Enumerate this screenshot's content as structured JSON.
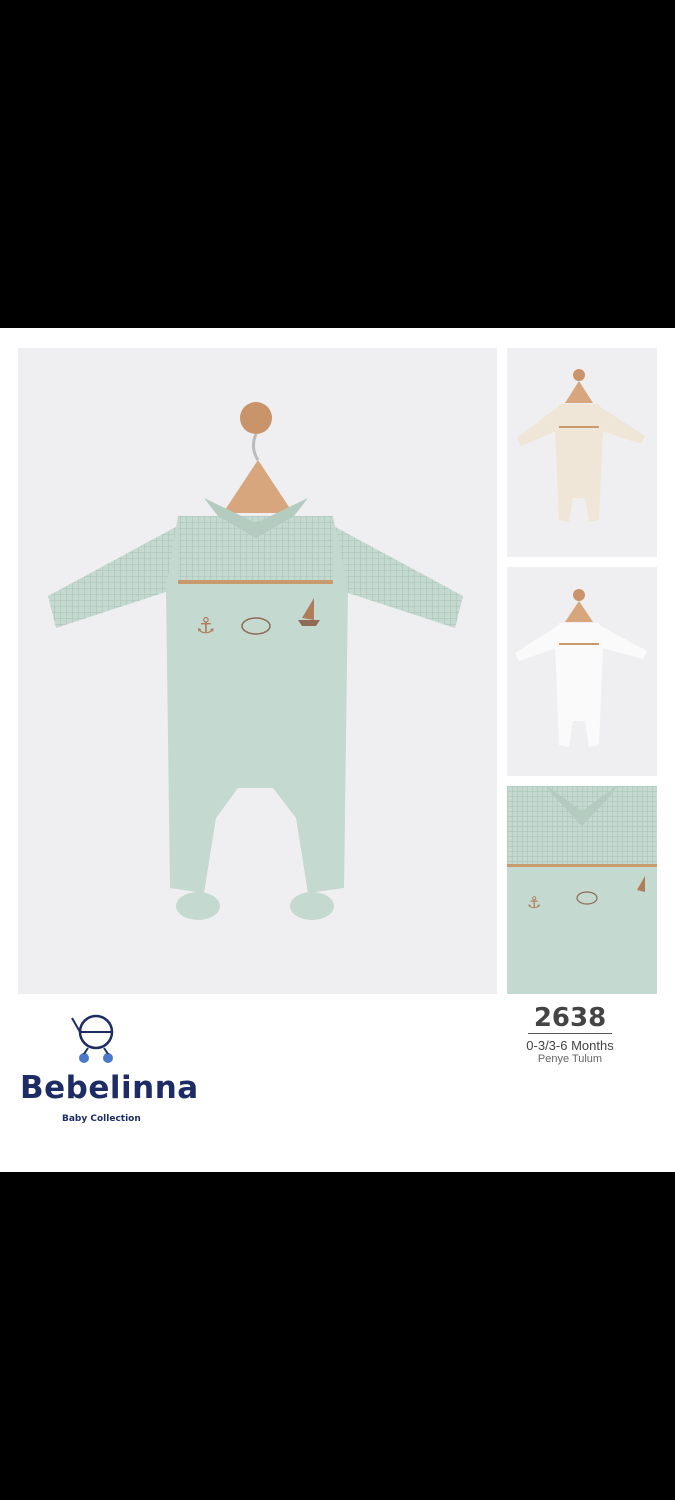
{
  "brand": {
    "name": "Bebelinna",
    "tagline": "Baby Collection"
  },
  "product": {
    "code": "2638",
    "sizes": "0-3/3-6 Months",
    "name": "Penye Tulum"
  },
  "colors": {
    "main_variant": "#c4d9cf",
    "cream_variant": "#efe6d8",
    "white_variant": "#fafafa",
    "brand_navy": "#1e2c66",
    "trim": "#c99a6e"
  },
  "images": [
    {
      "label": "main-product-photo",
      "variant": "mint"
    },
    {
      "label": "thumbnail",
      "variant": "cream"
    },
    {
      "label": "thumbnail",
      "variant": "white"
    },
    {
      "label": "thumbnail",
      "variant": "mint detail"
    }
  ]
}
